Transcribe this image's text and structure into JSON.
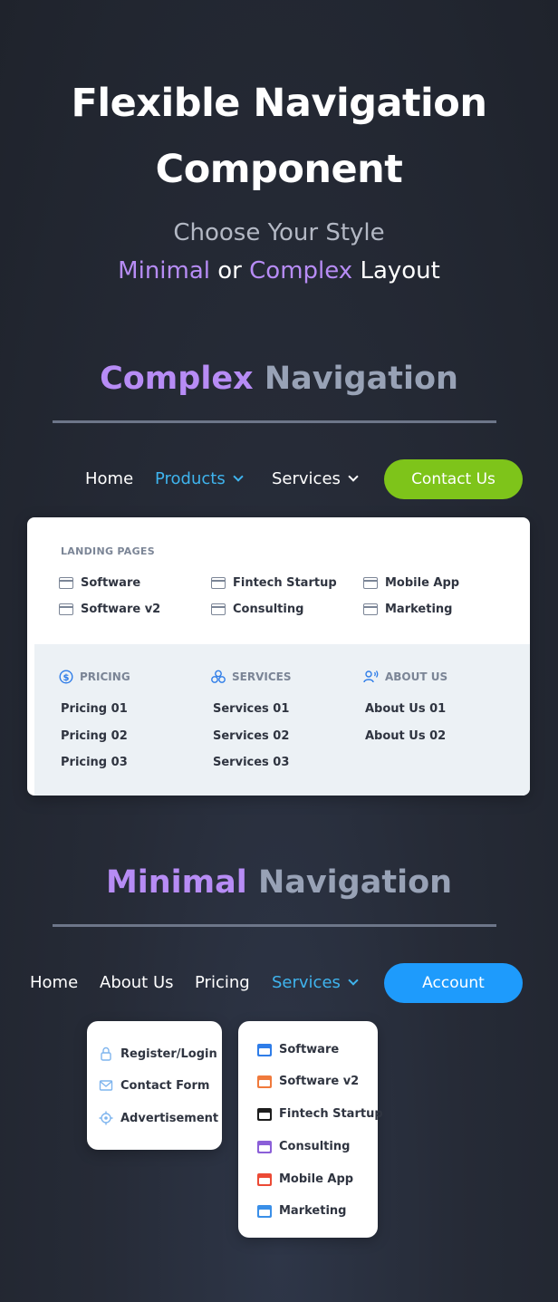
{
  "hero": {
    "title_line1": "Flexible Navigation",
    "title_line2": "Component",
    "subtitle_line1": "Choose Your Style",
    "subtitle_minimal": "Minimal",
    "subtitle_or": "or",
    "subtitle_complex": "Complex",
    "subtitle_layout": "Layout"
  },
  "complex": {
    "heading_accent": "Complex",
    "heading_rest": "Navigation",
    "nav": {
      "home": "Home",
      "products": "Products",
      "services": "Services",
      "cta": "Contact Us"
    },
    "landing_pages_heading": "LANDING PAGES",
    "landing_pages": [
      [
        "Software",
        "Fintech Startup",
        "Mobile App"
      ],
      [
        "Software v2",
        "Consulting",
        "Marketing"
      ]
    ],
    "pricing": {
      "heading": "PRICING",
      "items": [
        "Pricing 01",
        "Pricing 02",
        "Pricing 03"
      ]
    },
    "services": {
      "heading": "SERVICES",
      "items": [
        "Services 01",
        "Services 02",
        "Services 03"
      ]
    },
    "about": {
      "heading": "ABOUT US",
      "items": [
        "About Us 01",
        "About Us 02"
      ]
    }
  },
  "minimal": {
    "heading_accent": "Minimal",
    "heading_rest": "Navigation",
    "nav": {
      "home": "Home",
      "about": "About Us",
      "pricing": "Pricing",
      "services": "Services",
      "cta": "Account"
    },
    "dropdown_left": [
      "Register/Login",
      "Contact Form",
      "Advertisement"
    ],
    "dropdown_right": [
      "Software",
      "Software v2",
      "Fintech Startup",
      "Consulting",
      "Mobile App",
      "Marketing"
    ]
  },
  "colors": {
    "accent_purple": "#b78cf5",
    "active_blue": "#3fb4ee",
    "contact_green": "#7ec41a",
    "account_blue": "#1e9bfc",
    "dropdown_icons": [
      "#2f7de8",
      "#f07a3c",
      "#1d1d1d",
      "#8b5fd8",
      "#ec4a35",
      "#3a8fe8"
    ]
  }
}
